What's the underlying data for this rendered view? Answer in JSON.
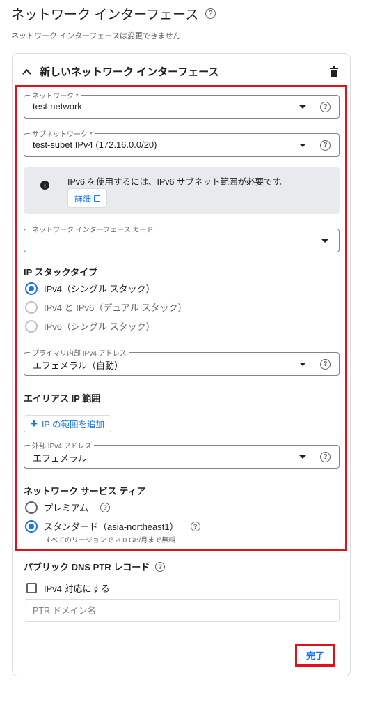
{
  "page": {
    "title": "ネットワーク インターフェース",
    "subtitle": "ネットワーク インターフェースは変更できません",
    "help_glyph": "?"
  },
  "card": {
    "header": "新しいネットワーク インターフェース",
    "network": {
      "label": "ネットワーク *",
      "value": "test-network"
    },
    "subnetwork": {
      "label": "サブネットワーク *",
      "value": "test-subet IPv4 (172.16.0.0/20)"
    },
    "info": {
      "text": "IPv6 を使用するには、IPv6 サブネット範囲が必要です。",
      "button": "詳細",
      "icon_glyph": "i"
    },
    "nic_card": {
      "label": "ネットワーク インターフェース カード",
      "value": "–"
    },
    "ip_stack": {
      "title": "IP スタックタイプ",
      "options": [
        {
          "label": "IPv4（シングル スタック）",
          "selected": true,
          "disabled": false
        },
        {
          "label": "IPv4 と IPv6（デュアル スタック）",
          "selected": false,
          "disabled": true
        },
        {
          "label": "IPv6（シングル スタック）",
          "selected": false,
          "disabled": true
        }
      ]
    },
    "primary_ip": {
      "label": "プライマリ内部 IPv4 アドレス",
      "value": "エフェメラル（自動）"
    },
    "alias": {
      "title": "エイリアス IP 範囲",
      "add_button": "IP の範囲を追加",
      "plus": "+"
    },
    "external_ip": {
      "label": "外部 IPv4 アドレス",
      "value": "エフェメラル"
    },
    "service_tier": {
      "title": "ネットワーク サービス ティア",
      "premium": "プレミアム",
      "standard": "スタンダード（asia-northeast1）",
      "standard_note": "すべてのリージョンで 200 GB/月まで無料"
    },
    "dns": {
      "title": "パブリック DNS PTR レコード",
      "checkbox_label": "IPv4 対応にする",
      "ptr_placeholder": "PTR ドメイン名"
    },
    "done_button": "完了"
  },
  "colors": {
    "accent": "#1a73e8",
    "highlight": "#e3101c",
    "info_bg": "#e8eaed"
  }
}
